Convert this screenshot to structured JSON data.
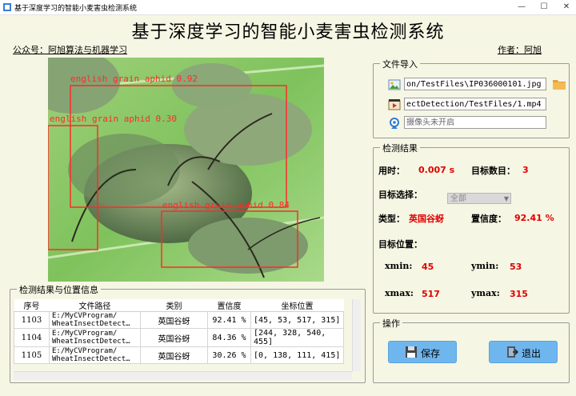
{
  "window": {
    "title": "基于深度学习的智能小麦害虫检测系统",
    "min": "—",
    "max": "☐",
    "close": "✕"
  },
  "header": {
    "title": "基于深度学习的智能小麦害虫检测系统",
    "left_info": "公众号：阿旭算法与机器学习",
    "right_info": "作者：阿旭"
  },
  "detections": [
    {
      "label": "english grain aphid 0.92"
    },
    {
      "label": "english grain aphid 0.30"
    },
    {
      "label": "english grain aphid 0.84"
    }
  ],
  "file_import": {
    "title": "文件导入",
    "image_path": "on/TestFiles\\IP036000101.jpg",
    "video_path": "ectDetection/TestFiles/1.mp4",
    "camera_status": "摄像头未开启",
    "icons": [
      "image-icon",
      "video-icon",
      "camera-icon",
      "folder-icon"
    ]
  },
  "results": {
    "title": "检测结果",
    "time_label": "用时：",
    "time_value": "0.007 s",
    "count_label": "目标数目：",
    "count_value": "3",
    "select_label": "目标选择：",
    "select_value": "全部",
    "type_label": "类型：",
    "type_value": "英国谷蚜",
    "conf_label": "置信度：",
    "conf_value": "92.41 %",
    "pos_label": "目标位置：",
    "xmin_label": "xmin:",
    "xmin_value": "45",
    "ymin_label": "ymin:",
    "ymin_value": "53",
    "xmax_label": "xmax:",
    "xmax_value": "517",
    "ymax_label": "ymax:",
    "ymax_value": "315"
  },
  "actions": {
    "title": "操作",
    "save": "保存",
    "exit": "退出"
  },
  "table": {
    "title": "检测结果与位置信息",
    "columns": [
      "序号",
      "文件路径",
      "类别",
      "置信度",
      "坐标位置"
    ],
    "rows": [
      {
        "id": "1103",
        "path1": "E:/MyCVProgram/",
        "path2": "WheatInsectDetect…",
        "cls": "英国谷蚜",
        "conf": "92.41 %",
        "coords": "[45, 53, 517, 315]"
      },
      {
        "id": "1104",
        "path1": "E:/MyCVProgram/",
        "path2": "WheatInsectDetect…",
        "cls": "英国谷蚜",
        "conf": "84.36 %",
        "coords": "[244, 328, 540, 455]"
      },
      {
        "id": "1105",
        "path1": "E:/MyCVProgram/",
        "path2": "WheatInsectDetect…",
        "cls": "英国谷蚜",
        "conf": "30.26 %",
        "coords": "[0, 138, 111, 415]"
      }
    ]
  }
}
